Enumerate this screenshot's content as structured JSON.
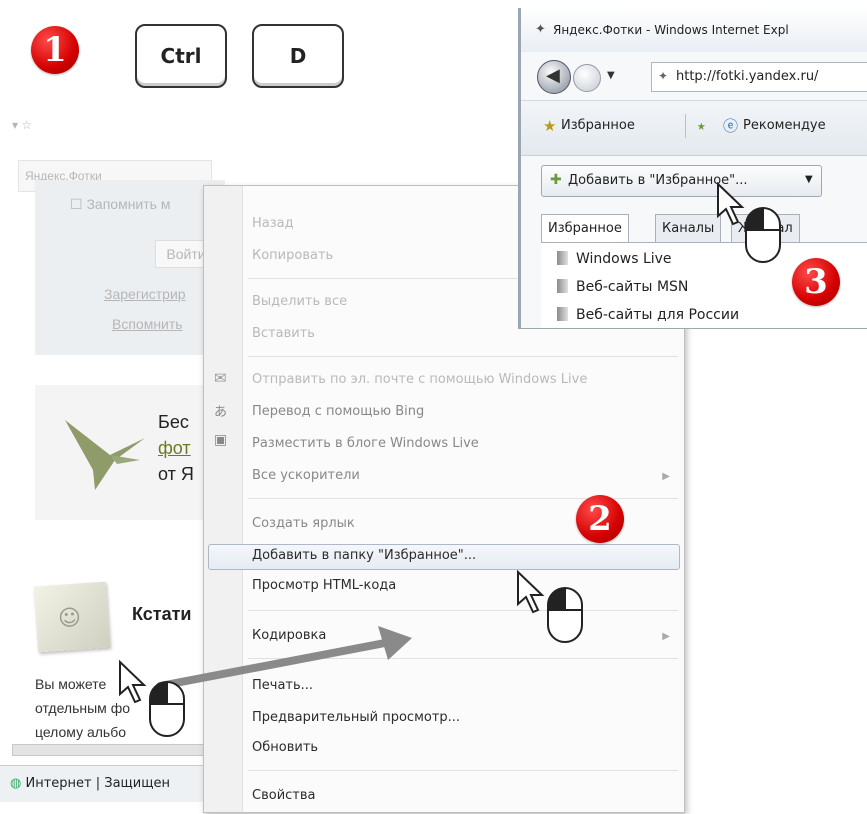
{
  "step_badges": [
    "1",
    "2",
    "3"
  ],
  "keys": [
    "Ctrl",
    "D"
  ],
  "background_page": {
    "tab_title": "Яндекс.Фотки",
    "remember_label": "Запомнить м",
    "login_button": "Войти",
    "register_link": "Зарегистрир",
    "forgot_link": "Вспомнить",
    "promo_lines": [
      "Бес",
      "фот",
      "от Я"
    ],
    "section_title": "Кстати",
    "body_lines": [
      "Вы можете",
      "отдельным фо",
      "целому альбо"
    ],
    "status_bar": "Интернет | Защищен"
  },
  "context_menu": {
    "items": [
      {
        "label": "Назад",
        "state": "dim"
      },
      {
        "label": "Копировать",
        "state": "dim"
      },
      {
        "label": "Выделить все",
        "state": "dim"
      },
      {
        "label": "Вставить",
        "state": "dim"
      },
      {
        "label": "Отправить по эл. почте с помощью Windows Live",
        "state": "dim"
      },
      {
        "label": "Перевод с помощью Bing",
        "state": "mid"
      },
      {
        "label": "Разместить в блоге Windows Live",
        "state": "mid"
      },
      {
        "label": "Все ускорители",
        "state": "mid"
      },
      {
        "label": "Создать ярлык",
        "state": "mid"
      },
      {
        "label": "Добавить в папку \"Избранное\"...",
        "state": "dark"
      },
      {
        "label": "Просмотр HTML-кода",
        "state": "dark"
      },
      {
        "label": "Кодировка",
        "state": "dark"
      },
      {
        "label": "Печать...",
        "state": "dark"
      },
      {
        "label": "Предварительный просмотр...",
        "state": "dark"
      },
      {
        "label": "Обновить",
        "state": "dark"
      },
      {
        "label": "Свойства",
        "state": "dark"
      }
    ]
  },
  "ie_window": {
    "title": "Яндекс.Фотки - Windows Internet Expl",
    "address": "http://fotki.yandex.ru/",
    "favorites_label": "Избранное",
    "recommended_label": "Рекомендуе",
    "add_favorites_button": "Добавить в \"Избранное\"...",
    "tabs": [
      "Избранное",
      "Каналы",
      "Журнал"
    ],
    "favorites": [
      "Windows Live",
      "Веб-сайты MSN",
      "Веб-сайты для России"
    ]
  },
  "colors": {
    "badge_red": "#d40000",
    "arrow_gray": "#8a8a8a"
  }
}
